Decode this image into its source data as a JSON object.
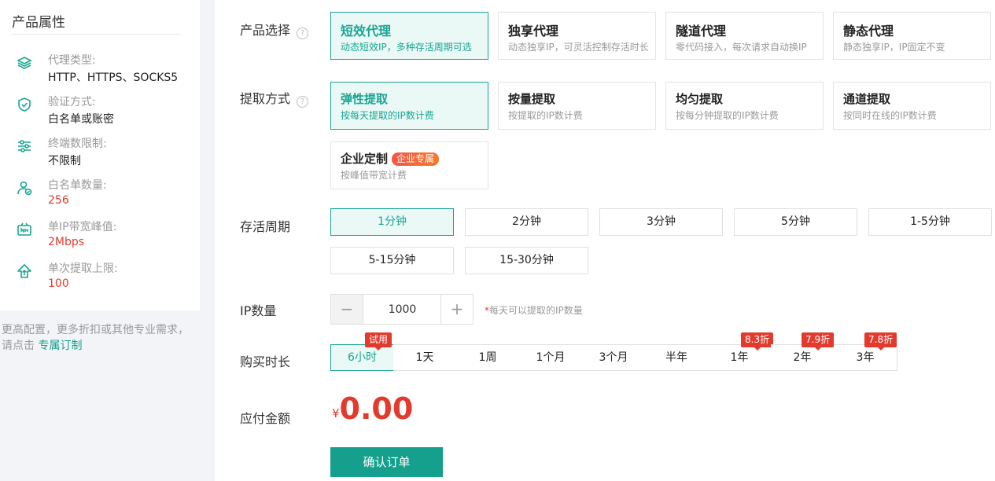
{
  "sidebar": {
    "title": "产品属性",
    "items": [
      {
        "icon": "layers-icon",
        "label": "代理类型:",
        "value": "HTTP、HTTPS、SOCKS5",
        "highlight": false
      },
      {
        "icon": "shield-check-icon",
        "label": "验证方式:",
        "value": "白名单或账密",
        "highlight": false
      },
      {
        "icon": "sliders-icon",
        "label": "终端数限制:",
        "value": "不限制",
        "highlight": false
      },
      {
        "icon": "user-check-icon",
        "label": "白名单数量:",
        "value": "256",
        "highlight": true
      },
      {
        "icon": "bandwidth-icon",
        "label": "单IP带宽峰值:",
        "value": "2Mbps",
        "highlight": true
      },
      {
        "icon": "upload-house-icon",
        "label": "单次提取上限:",
        "value": "100",
        "highlight": true
      }
    ],
    "note": "更高配置，更多折扣或其他专业需求，请点击",
    "note_link": "专属订制"
  },
  "product": {
    "label": "产品选择",
    "options": [
      {
        "title": "短效代理",
        "desc": "动态短效IP，多种存活周期可选",
        "active": true
      },
      {
        "title": "独享代理",
        "desc": "动态独享IP，可灵活控制存活时长",
        "active": false
      },
      {
        "title": "隧道代理",
        "desc": "零代码接入，每次请求自动换IP",
        "active": false
      },
      {
        "title": "静态代理",
        "desc": "静态独享IP，IP固定不变",
        "active": false
      }
    ]
  },
  "extract": {
    "label": "提取方式",
    "options": [
      {
        "title": "弹性提取",
        "desc": "按每天提取的IP数计费",
        "active": true
      },
      {
        "title": "按量提取",
        "desc": "按提取的IP数计费",
        "active": false
      },
      {
        "title": "均匀提取",
        "desc": "按每分钟提取的IP数计费",
        "active": false
      },
      {
        "title": "通道提取",
        "desc": "按同时在线的IP数计费",
        "active": false
      },
      {
        "title": "企业定制",
        "desc": "按峰值带宽计费",
        "tag": "企业专属",
        "active": false
      }
    ]
  },
  "lifetime": {
    "label": "存活周期",
    "options": [
      "1分钟",
      "2分钟",
      "3分钟",
      "5分钟",
      "1-5分钟",
      "5-15分钟",
      "15-30分钟"
    ],
    "selected": "1分钟"
  },
  "ip_count": {
    "label": "IP数量",
    "value": "1000",
    "minus": "−",
    "plus": "+",
    "note_star": "*",
    "note": "每天可以提取的IP数量"
  },
  "duration": {
    "label": "购买时长",
    "options": [
      {
        "label": "6小时",
        "badge": "试用"
      },
      {
        "label": "1天",
        "badge": ""
      },
      {
        "label": "1周",
        "badge": ""
      },
      {
        "label": "1个月",
        "badge": ""
      },
      {
        "label": "3个月",
        "badge": ""
      },
      {
        "label": "半年",
        "badge": ""
      },
      {
        "label": "1年",
        "badge": "8.3折"
      },
      {
        "label": "2年",
        "badge": "7.9折"
      },
      {
        "label": "3年",
        "badge": "7.8折"
      }
    ],
    "selected": "6小时"
  },
  "payment": {
    "label": "应付金额",
    "currency": "¥",
    "amount": "0.00"
  },
  "confirm_label": "确认订单",
  "colors": {
    "accent": "#19a591",
    "button": "#14a08c",
    "price": "#e23b2e",
    "sidebar_bg": "#f2f4f8"
  }
}
